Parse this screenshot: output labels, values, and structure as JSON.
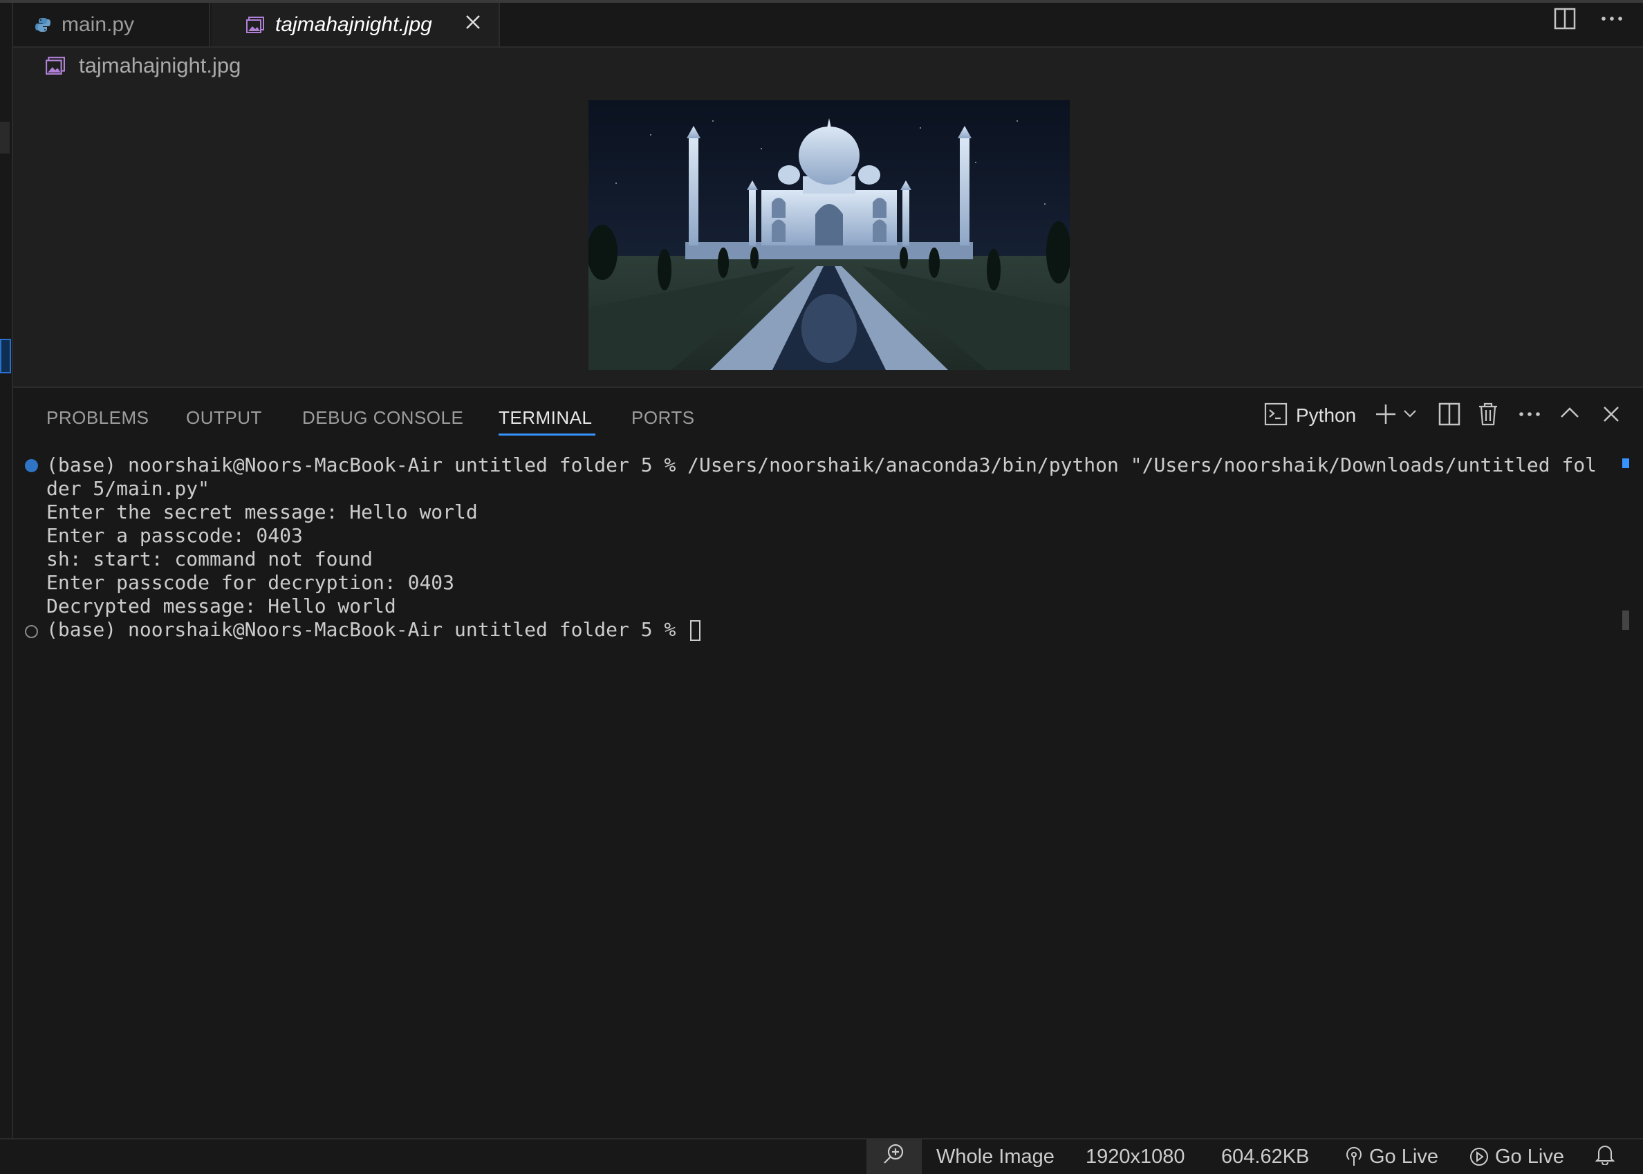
{
  "tabs": [
    {
      "label": "main.py",
      "icon": "python-icon",
      "active": false
    },
    {
      "label": "tajmahajnight.jpg",
      "icon": "image-file-icon",
      "active": true
    }
  ],
  "breadcrumb": {
    "label": "tajmahajnight.jpg",
    "icon": "image-file-icon"
  },
  "image_preview": {
    "alt": "tajmahajnight.jpg"
  },
  "panel": {
    "tabs": [
      "PROBLEMS",
      "OUTPUT",
      "DEBUG CONSOLE",
      "TERMINAL",
      "PORTS"
    ],
    "active_tab": "TERMINAL",
    "shell_label": "Python"
  },
  "terminal": {
    "lines": [
      "(base) noorshaik@Noors-MacBook-Air untitled folder 5 % /Users/noorshaik/anaconda3/bin/python \"/Users/noorshaik/Downloads/untitled fol",
      "der 5/main.py\"",
      "Enter the secret message: Hello world",
      "Enter a passcode: 0403",
      "sh: start: command not found",
      "Enter passcode for decryption: 0403",
      "Decrypted message: Hello world",
      "(base) noorshaik@Noors-MacBook-Air untitled folder 5 % "
    ]
  },
  "statusbar": {
    "zoom_label": "Whole Image",
    "dimensions": "1920x1080",
    "file_size": "604.62KB",
    "go_live_1": "Go Live",
    "go_live_2": "Go Live"
  },
  "colors": {
    "accent": "#3794ff",
    "background": "#181818",
    "editor": "#1f1f1f"
  }
}
